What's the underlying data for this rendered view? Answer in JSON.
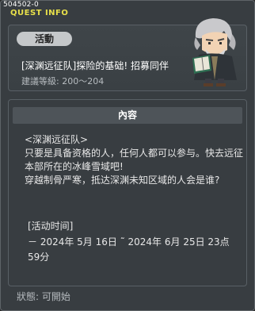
{
  "header": {
    "quest_id": "504502-0",
    "title": "QUEST INFO"
  },
  "quest": {
    "tag": "活動",
    "title": "[深渊远征队]探险的基础! 招募同伴",
    "level_requirement": "建議等級: 200〜204"
  },
  "content": {
    "header": "內容",
    "lines": [
      "<深渊远征队>",
      "只要是具备资格的人，任何人都可以参与。快去远征本部所在的冰峰雪域吧!",
      "穿越制骨严寒，抵达深渊未知区域的人会是谁?"
    ],
    "time_label": "[活动时间]",
    "time_value": "－ 2024年 5月 16日 ˜ 2024年 6月 25日 23点 59分"
  },
  "status": "狀態: 可開始"
}
